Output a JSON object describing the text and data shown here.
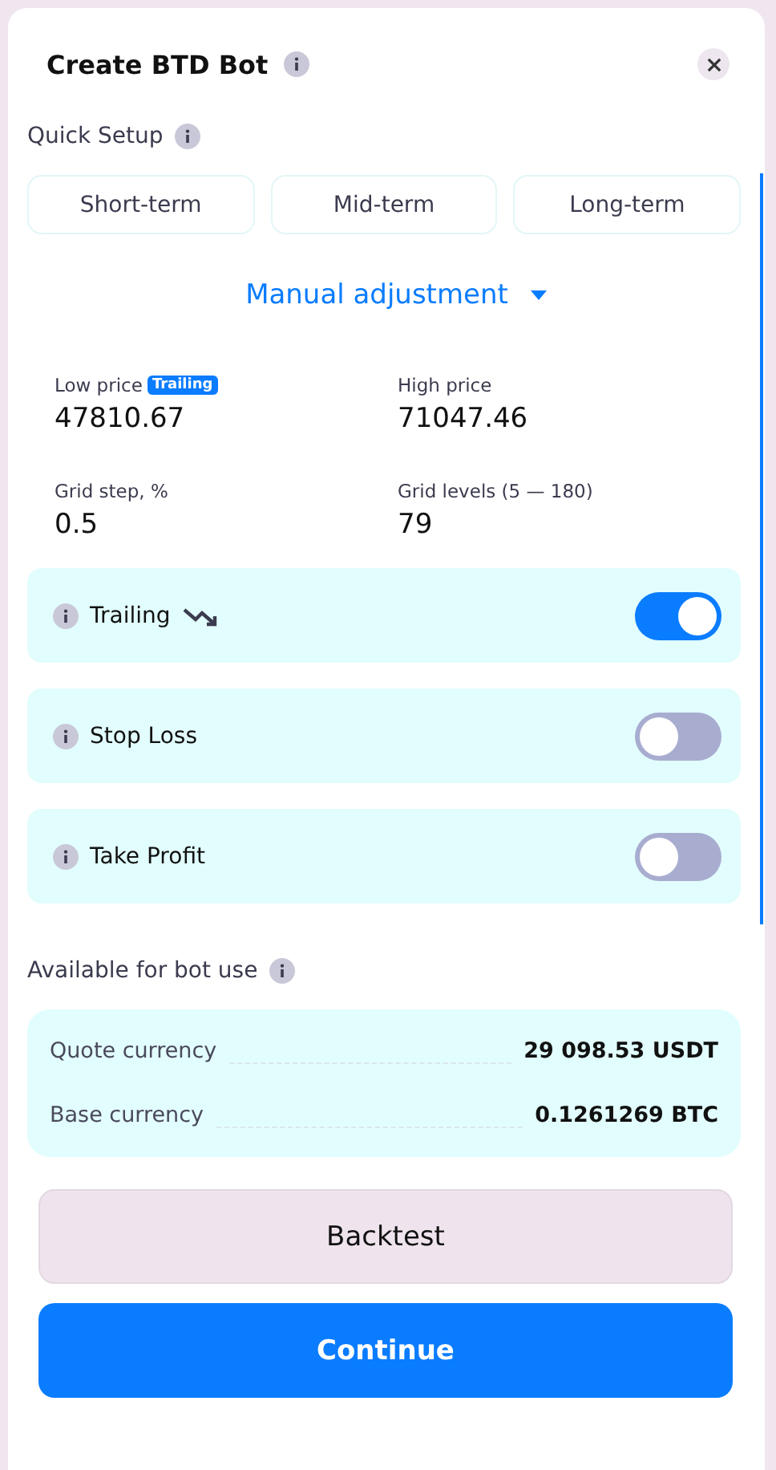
{
  "dialog": {
    "title": "Create BTD Bot"
  },
  "quick_setup": {
    "label": "Quick Setup",
    "presets": [
      {
        "label": "Short-term",
        "selected": false
      },
      {
        "label": "Mid-term",
        "selected": false
      },
      {
        "label": "Long-term",
        "selected": false
      }
    ]
  },
  "manual_adjustment": {
    "label": "Manual adjustment",
    "expanded": true
  },
  "fields": [
    {
      "label": "Low price",
      "badge": "Trailing",
      "value": "47810.67"
    },
    {
      "label": "High price",
      "value": "71047.46"
    },
    {
      "label": "Grid step, %",
      "value": "0.5"
    },
    {
      "label": "Grid levels (5 — 180)",
      "value": "79"
    }
  ],
  "toggles": [
    {
      "label": "Trailing",
      "on": true,
      "trend_icon": true
    },
    {
      "label": "Stop Loss",
      "on": false
    },
    {
      "label": "Take Profit",
      "on": false
    }
  ],
  "available": {
    "label": "Available for bot use",
    "rows": [
      {
        "label": "Quote currency",
        "value": "29 098.53 USDT"
      },
      {
        "label": "Base currency",
        "value": "0.1261269 BTC"
      }
    ]
  },
  "buttons": [
    {
      "label": "Backtest",
      "kind": "secondary"
    },
    {
      "label": "Continue",
      "kind": "primary"
    }
  ]
}
